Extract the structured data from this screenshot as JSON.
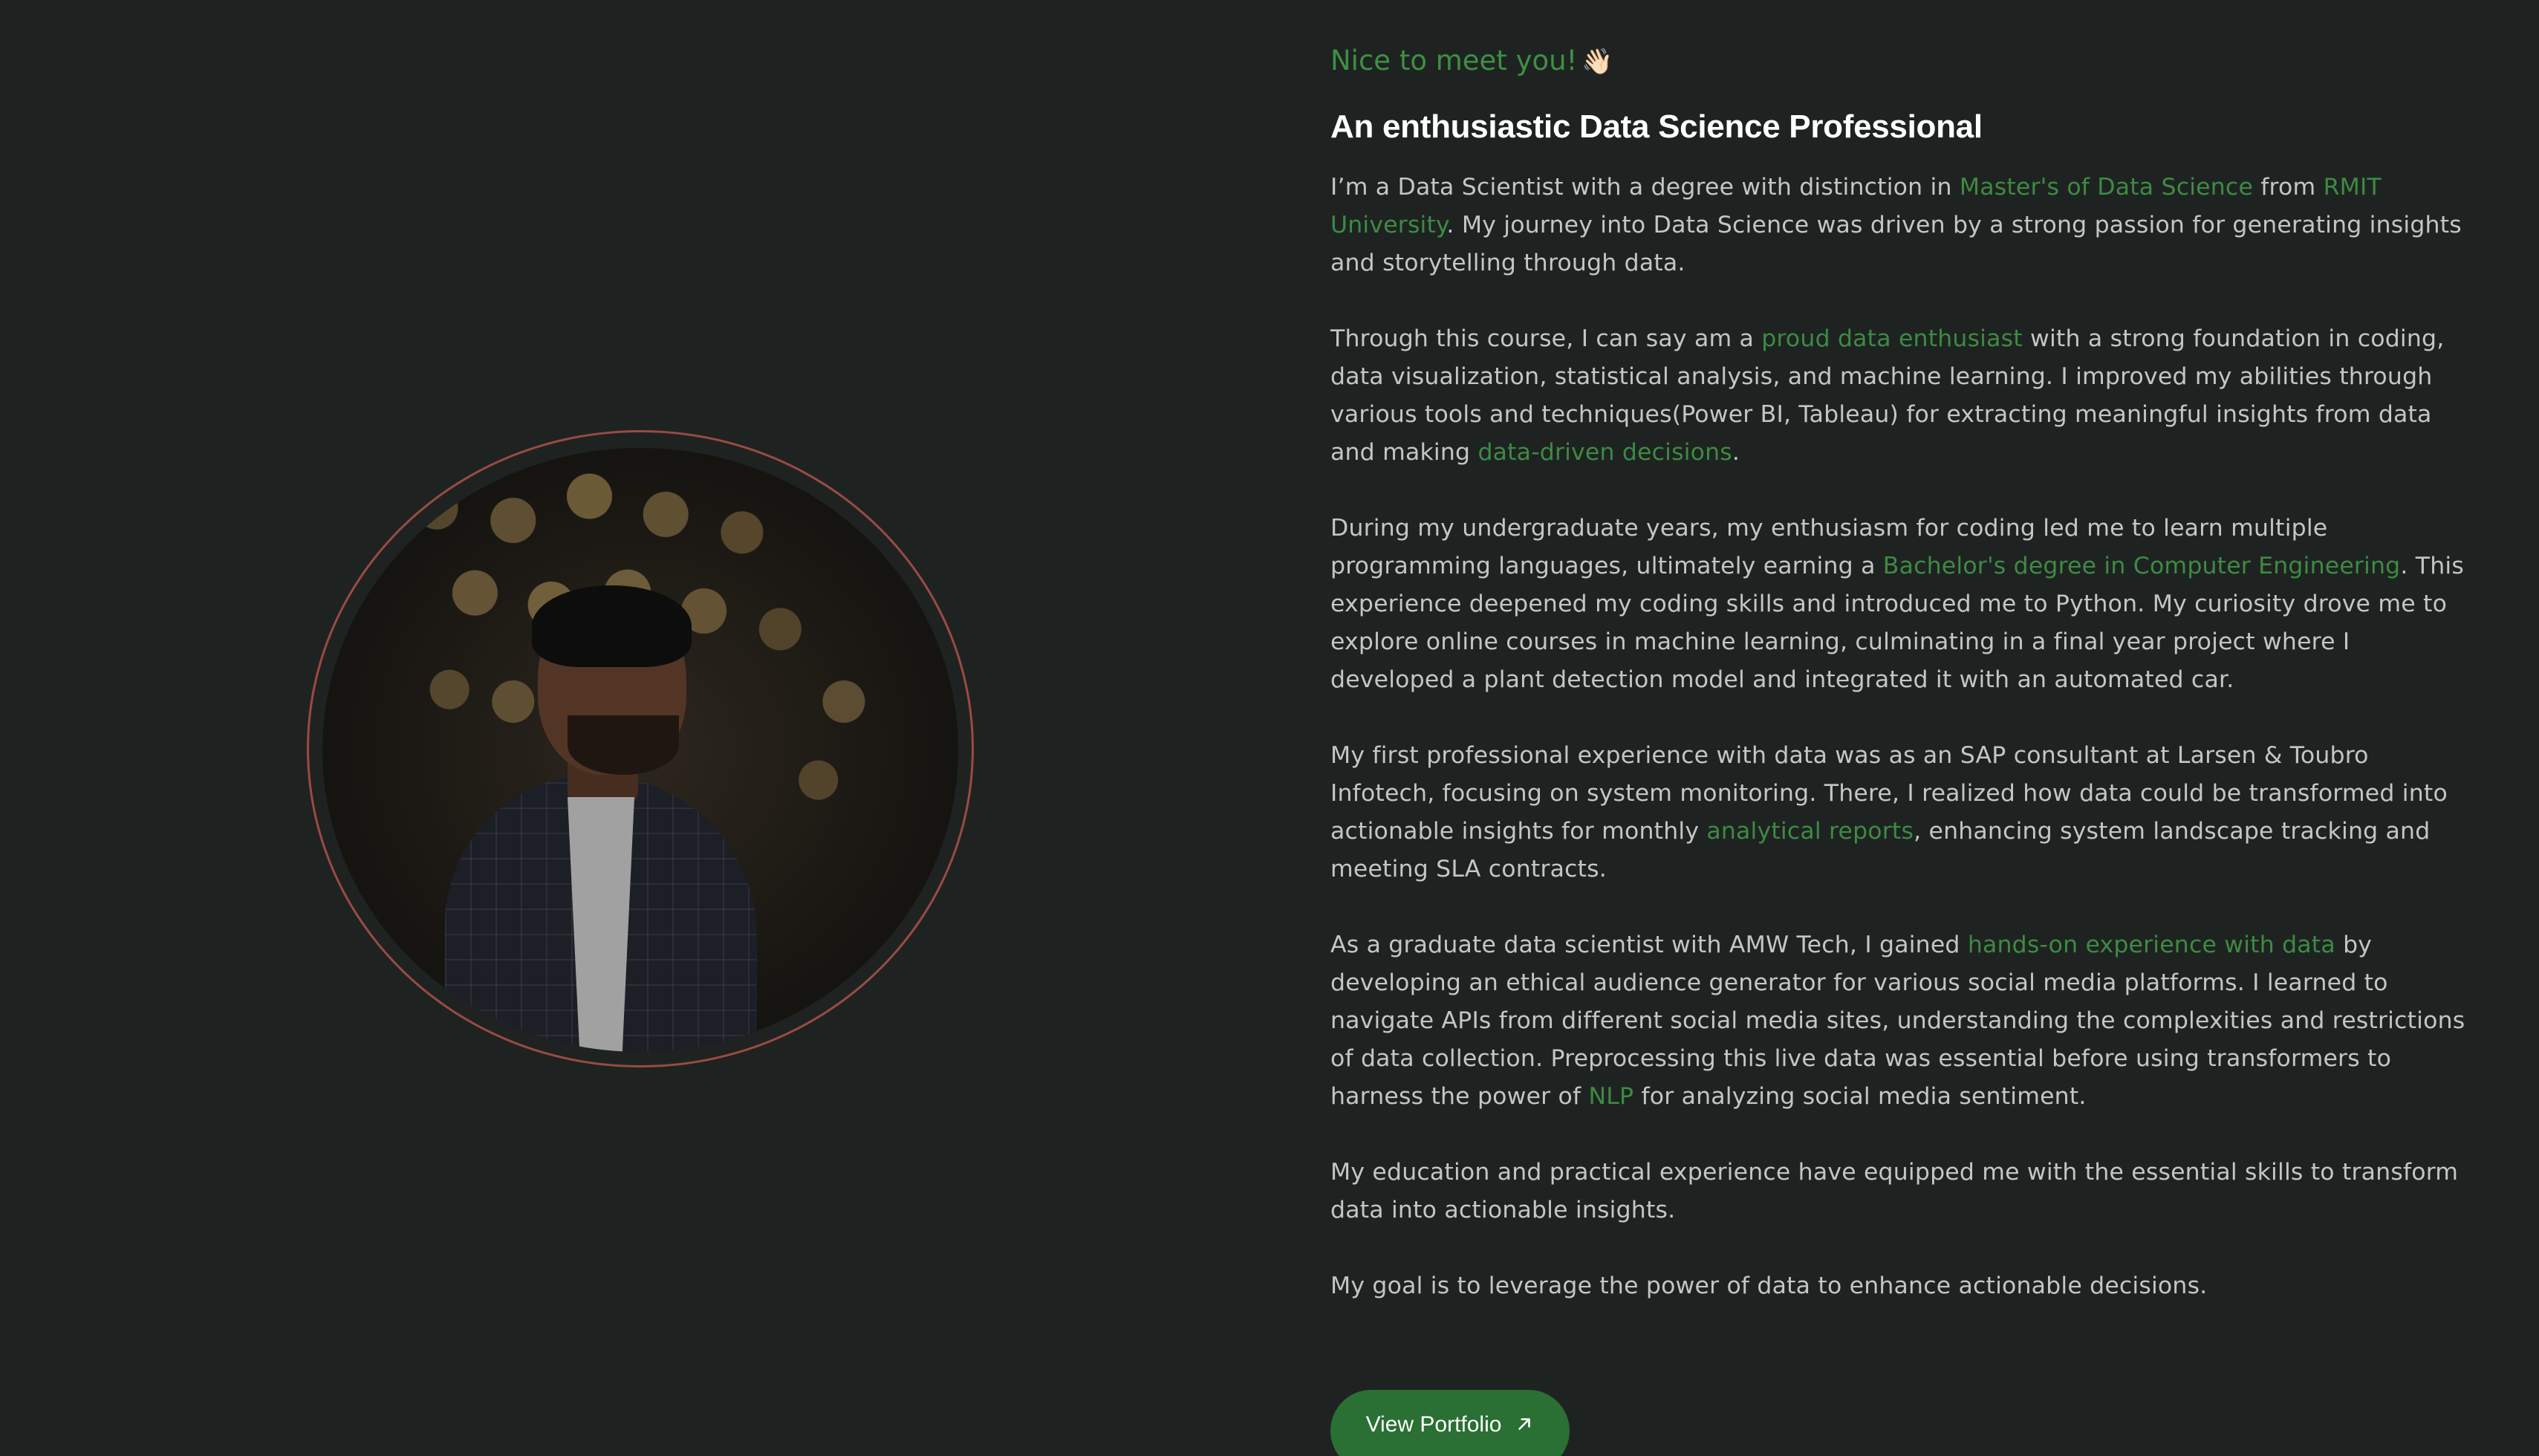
{
  "greeting": {
    "text": "Nice to meet you!",
    "emoji": "👋🏻"
  },
  "headline": "An enthusiastic Data Science Professional",
  "paragraphs": [
    {
      "parts": [
        {
          "t": "I’m a Data Scientist with a degree with distinction in "
        },
        {
          "t": "Master's of Data Science",
          "hl": true
        },
        {
          "t": " from "
        },
        {
          "t": "RMIT University",
          "hl": true
        },
        {
          "t": ". My journey into Data Science was driven by a strong passion for generating insights and storytelling through data."
        }
      ]
    },
    {
      "parts": [
        {
          "t": "Through this course, I can say am a "
        },
        {
          "t": "proud data enthusiast",
          "hl": true
        },
        {
          "t": " with a strong foundation in coding, data visualization, statistical analysis, and machine learning. I improved my abilities through various tools and techniques(Power BI, Tableau) for extracting meaningful insights from data and making "
        },
        {
          "t": "data-driven decisions",
          "hl": true
        },
        {
          "t": "."
        }
      ]
    },
    {
      "parts": [
        {
          "t": "During my undergraduate years, my enthusiasm for coding led me to learn multiple programming languages, ultimately earning a "
        },
        {
          "t": "Bachelor's degree in Computer Engineering",
          "hl": true
        },
        {
          "t": ". This experience deepened my coding skills and introduced me to Python. My curiosity drove me to explore online courses in machine learning, culminating in a final year project where I developed a plant detection model and integrated it with an automated car."
        }
      ]
    },
    {
      "parts": [
        {
          "t": "My first professional experience with data was as an SAP consultant at Larsen & Toubro Infotech, focusing on system monitoring. There, I realized how data could be transformed into actionable insights for monthly "
        },
        {
          "t": "analytical reports",
          "hl": true
        },
        {
          "t": ", enhancing system landscape tracking and meeting SLA contracts."
        }
      ]
    },
    {
      "parts": [
        {
          "t": "As a graduate data scientist with AMW Tech, I gained "
        },
        {
          "t": "hands-on experience with data",
          "hl": true
        },
        {
          "t": " by developing an ethical audience generator for various social media platforms. I learned to navigate APIs from different social media sites, understanding the complexities and restrictions of data collection. Preprocessing this live data was essential before using transformers to harness the power of "
        },
        {
          "t": "NLP",
          "hl": true
        },
        {
          "t": " for analyzing social media sentiment."
        }
      ]
    },
    {
      "parts": [
        {
          "t": "My education and practical experience have equipped me with the essential skills to transform data into actionable insights."
        }
      ]
    },
    {
      "parts": [
        {
          "t": "My goal is to leverage the power of data to enhance actionable decisions."
        }
      ]
    }
  ],
  "button": {
    "label": "View Portfolio",
    "icon": "arrow-up-right-icon"
  },
  "colors": {
    "background": "#1e2321",
    "accent": "#3e8a43",
    "button": "#2a6f33",
    "ring": "#9a4a44",
    "text": "#c3c6c4",
    "heading": "#ffffff"
  }
}
